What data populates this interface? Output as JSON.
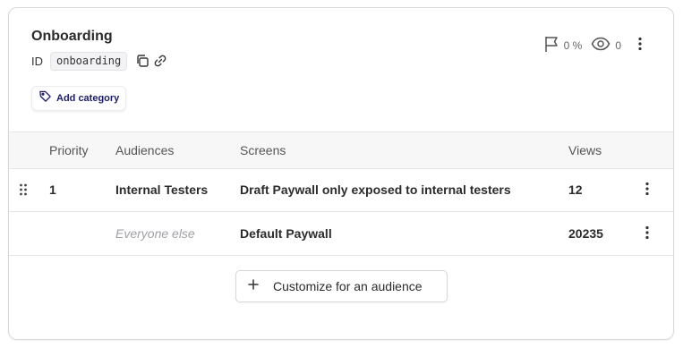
{
  "flow": {
    "title": "Onboarding",
    "id_label": "ID",
    "id_value": "onboarding",
    "add_category_label": "Add category",
    "percent_label": "0 %",
    "views_count": "0"
  },
  "table": {
    "headers": {
      "priority": "Priority",
      "audiences": "Audiences",
      "screens": "Screens",
      "views": "Views"
    },
    "rows": [
      {
        "priority": "1",
        "audience": "Internal Testers",
        "screen": "Draft Paywall only exposed to internal testers",
        "views": "12"
      },
      {
        "priority": "",
        "audience": "Everyone else",
        "screen": "Default Paywall",
        "views": "20235"
      }
    ]
  },
  "cta": {
    "label": "Customize for an audience"
  },
  "icons": {
    "copy": "copy-icon",
    "link": "link-icon",
    "tag": "tag-icon",
    "flag": "flag-icon",
    "eye": "eye-icon",
    "kebab": "kebab-menu-icon",
    "drag": "drag-handle-icon",
    "plus": "plus-icon"
  },
  "colors": {
    "accent": "#1c1d6b",
    "muted_text": "#a0a0a6",
    "header_bg": "#f7f7f8",
    "border": "#e4e4e7"
  }
}
